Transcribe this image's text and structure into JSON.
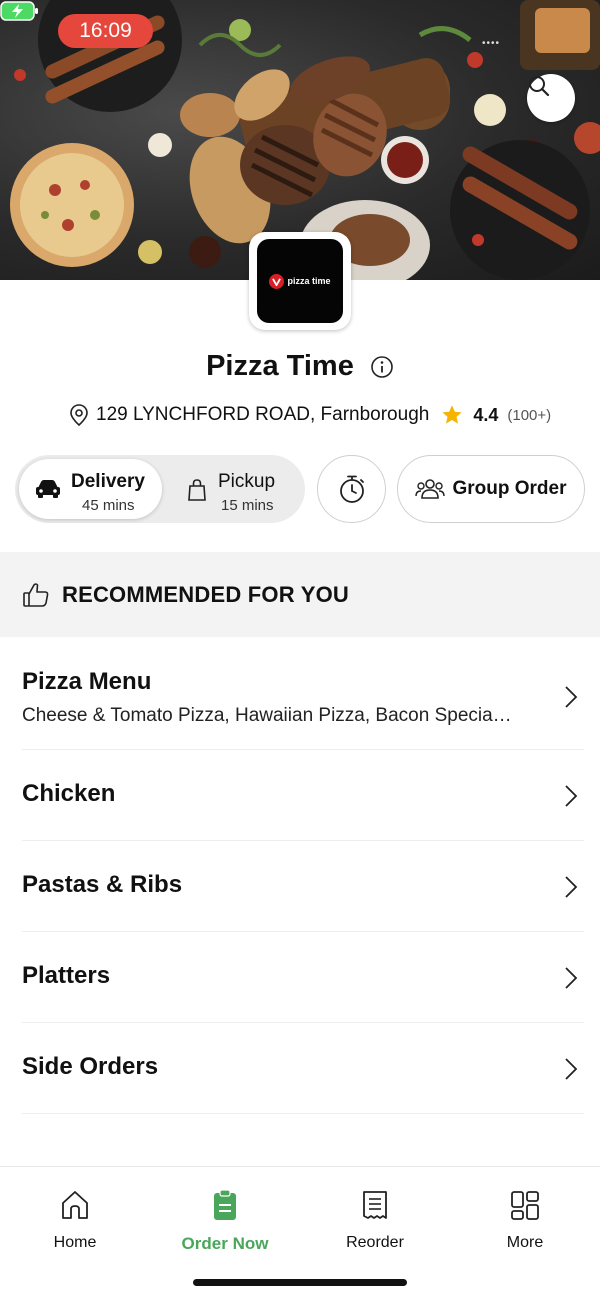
{
  "status_bar": {
    "time": "16:09"
  },
  "store": {
    "name": "Pizza Time",
    "logo_text": "pizza time",
    "address": "129 LYNCHFORD ROAD, Farnborough",
    "rating": "4.4",
    "rating_count": "(100+)"
  },
  "order_modes": {
    "delivery": {
      "label": "Delivery",
      "time": "45 mins",
      "selected": true
    },
    "pickup": {
      "label": "Pickup",
      "time": "15 mins",
      "selected": false
    }
  },
  "group_order_label": "Group Order",
  "recommended_label": "RECOMMENDED FOR YOU",
  "menu": [
    {
      "title": "Pizza Menu",
      "description": "Cheese & Tomato Pizza, Hawaiian Pizza, Bacon Specia…"
    },
    {
      "title": "Chicken"
    },
    {
      "title": "Pastas & Ribs"
    },
    {
      "title": "Platters"
    },
    {
      "title": "Side Orders"
    }
  ],
  "nav": {
    "home": "Home",
    "order_now": "Order Now",
    "reorder": "Reorder",
    "more": "More",
    "active": "order_now"
  },
  "colors": {
    "accent_green": "#49a65a",
    "time_pill": "#e5473d",
    "star": "#f5b400",
    "logo_red": "#d81f26"
  },
  "icons": [
    "search-icon",
    "info-icon",
    "location-pin-icon",
    "star-icon",
    "car-icon",
    "bag-icon",
    "timer-icon",
    "group-icon",
    "thumbs-up-icon",
    "chevron-right-icon",
    "home-icon",
    "order-now-icon",
    "receipt-icon",
    "grid-icon"
  ]
}
